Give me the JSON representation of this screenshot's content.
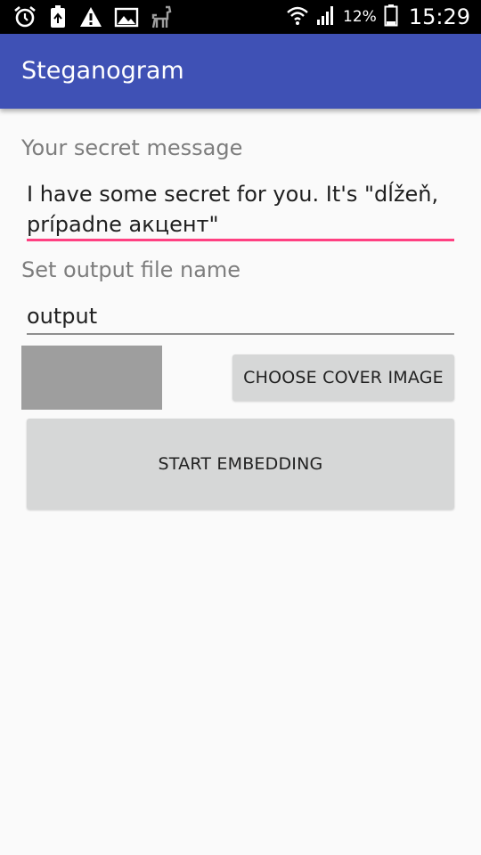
{
  "status_bar": {
    "battery_percent": "12%",
    "time": "15:29",
    "icons_left": [
      "alarm-icon",
      "battery-saver-icon",
      "warning-icon",
      "image-icon",
      "llama-icon"
    ],
    "icons_right": [
      "wifi-icon",
      "signal-icon",
      "battery-icon"
    ]
  },
  "app_bar": {
    "title": "Steganogram",
    "color": "#3f51b5"
  },
  "form": {
    "secret_label": "Your secret message",
    "secret_value": "I have some secret for you. It's \"dĺžeň, prípadne акцент\"",
    "output_label": "Set output file name",
    "output_value": "output",
    "accent_color": "#ff4081"
  },
  "buttons": {
    "choose_cover": "CHOOSE COVER IMAGE",
    "start_embedding": "START EMBEDDING"
  }
}
